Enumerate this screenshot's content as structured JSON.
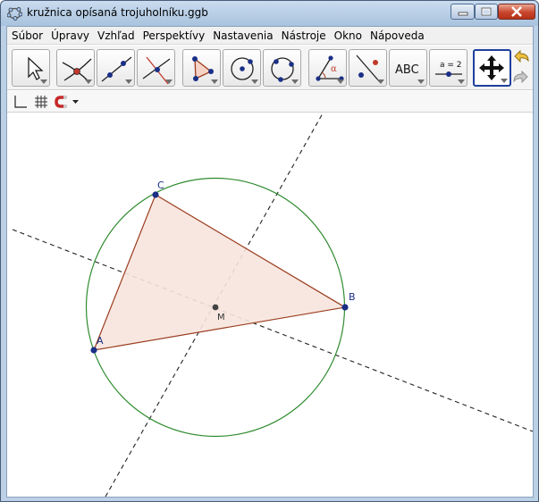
{
  "window": {
    "title": "kružnica opísaná trojuholníku.ggb",
    "controls": [
      "minimize-icon",
      "maximize-icon",
      "close-icon"
    ]
  },
  "menu": {
    "items": [
      "Súbor",
      "Úpravy",
      "Vzhľad",
      "Perspektívy",
      "Nastavenia",
      "Nástroje",
      "Okno",
      "Nápoveda"
    ]
  },
  "toolbar": {
    "tools": [
      {
        "icon": "move-pointer-icon"
      },
      {
        "icon": "intersect-point-icon"
      },
      {
        "icon": "line-through-two-points-icon"
      },
      {
        "icon": "perpendicular-line-icon"
      },
      {
        "icon": "polygon-icon"
      },
      {
        "icon": "circle-center-point-icon"
      },
      {
        "icon": "circle-through-three-points-icon"
      },
      {
        "icon": "angle-icon",
        "glyph": "α"
      },
      {
        "icon": "reflect-about-line-icon"
      },
      {
        "icon": "text-icon",
        "label": "ABC"
      },
      {
        "icon": "slider-icon",
        "label": "a = 2"
      },
      {
        "icon": "move-graphics-view-icon",
        "active": true
      }
    ],
    "undo_icon": "undo-icon",
    "redo_icon": "redo-icon"
  },
  "stylebar": {
    "items": [
      "axes-toggle-icon",
      "grid-toggle-icon",
      "point-capturing-magnet-icon",
      "dropdown-arrow-icon"
    ]
  },
  "construction": {
    "points": [
      {
        "name": "A",
        "color": "#1a2f86"
      },
      {
        "name": "B",
        "color": "#1a2f86"
      },
      {
        "name": "C",
        "color": "#1a2f86"
      },
      {
        "name": "M",
        "color": "#444444"
      }
    ],
    "triangle": {
      "fill": "#f6e4dd",
      "stroke": "#9b3c1e"
    },
    "circle": {
      "stroke": "#2e8b2e"
    },
    "bisector_style": "dashed black"
  }
}
